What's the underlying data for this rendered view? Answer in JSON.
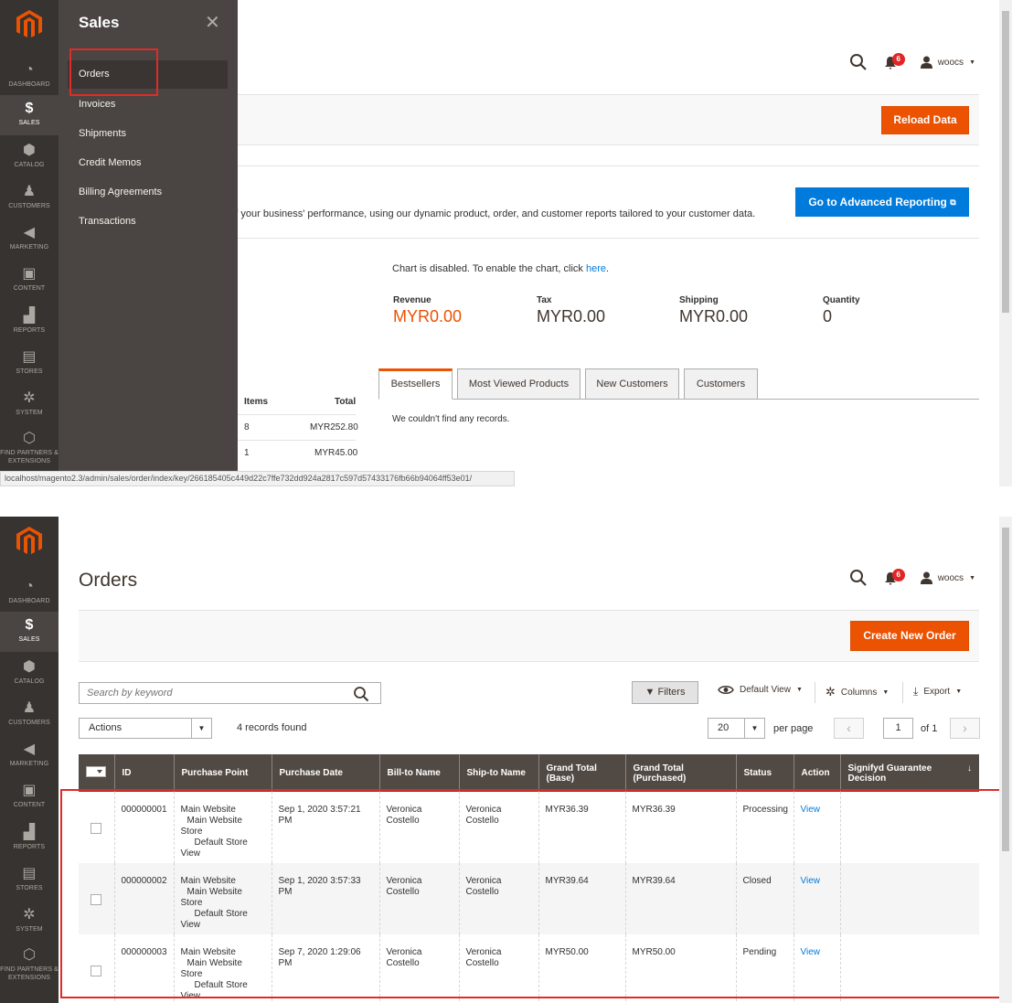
{
  "top": {
    "sidebar": [
      {
        "icon": "dashboard-icon",
        "label": "DASHBOARD"
      },
      {
        "icon": "dollar-icon",
        "label": "SALES"
      },
      {
        "icon": "cube-icon",
        "label": "CATALOG"
      },
      {
        "icon": "person-icon",
        "label": "CUSTOMERS"
      },
      {
        "icon": "megaphone-icon",
        "label": "MARKETING"
      },
      {
        "icon": "content-icon",
        "label": "CONTENT"
      },
      {
        "icon": "bar-chart-icon",
        "label": "REPORTS"
      },
      {
        "icon": "store-icon",
        "label": "STORES"
      },
      {
        "icon": "gear-icon",
        "label": "SYSTEM"
      },
      {
        "icon": "box-icon",
        "label": "FIND PARTNERS & EXTENSIONS"
      }
    ],
    "flyout": {
      "title": "Sales",
      "items": [
        "Orders",
        "Invoices",
        "Shipments",
        "Credit Memos",
        "Billing Agreements",
        "Transactions"
      ]
    },
    "header": {
      "notifications": "6",
      "user": "woocs"
    },
    "reload_label": "Reload Data",
    "advanced_reporting_label": "Go to Advanced Reporting",
    "advanced_text": "d of your business' performance, using our dynamic product, order, and customer reports tailored to your customer data.",
    "chart_disabled_text": "Chart is disabled. To enable the chart, click ",
    "chart_here_link": "here",
    "chart_disabled_end": ".",
    "stats": [
      {
        "label": "Revenue",
        "value": "MYR0.00"
      },
      {
        "label": "Tax",
        "value": "MYR0.00"
      },
      {
        "label": "Shipping",
        "value": "MYR0.00"
      },
      {
        "label": "Quantity",
        "value": "0"
      }
    ],
    "tabs": [
      "Bestsellers",
      "Most Viewed Products",
      "New Customers",
      "Customers"
    ],
    "tab_empty": "We couldn't find any records.",
    "last_orders": {
      "headers": [
        "Items",
        "Total"
      ],
      "rows": [
        {
          "items": "8",
          "total": "MYR252.80"
        },
        {
          "items": "1",
          "total": "MYR45.00"
        }
      ]
    },
    "status_url": "localhost/magento2.3/admin/sales/order/index/key/266185405c449d22c7ffe732dd924a2817c597d57433176fb66b94064ff53e01/"
  },
  "bottom": {
    "page_title": "Orders",
    "header": {
      "notifications": "6",
      "user": "woocs"
    },
    "create_label": "Create New Order",
    "search_placeholder": "Search by keyword",
    "filters_label": "Filters",
    "view_label": "Default View",
    "columns_label": "Columns",
    "export_label": "Export",
    "actions_label": "Actions",
    "records_found": "4 records found",
    "per_page_value": "20",
    "per_page_label": "per page",
    "page_value": "1",
    "page_of": "of 1",
    "columns": [
      "ID",
      "Purchase Point",
      "Purchase Date",
      "Bill-to Name",
      "Ship-to Name",
      "Grand Total (Base)",
      "Grand Total (Purchased)",
      "Status",
      "Action",
      "Signifyd Guarantee Decision"
    ],
    "rows": [
      {
        "id": "000000001",
        "pp1": "Main Website",
        "pp2": "Main Website",
        "pp3": "Store",
        "pp4": "Default Store",
        "pp5": "View",
        "date": "Sep 1, 2020 3:57:21 PM",
        "bill1": "Veronica",
        "bill2": "Costello",
        "ship1": "Veronica",
        "ship2": "Costello",
        "base": "MYR36.39",
        "purchased": "MYR36.39",
        "status": "Processing",
        "action": "View"
      },
      {
        "id": "000000002",
        "pp1": "Main Website",
        "pp2": "Main Website",
        "pp3": "Store",
        "pp4": "Default Store",
        "pp5": "View",
        "date": "Sep 1, 2020 3:57:33 PM",
        "bill1": "Veronica",
        "bill2": "Costello",
        "ship1": "Veronica",
        "ship2": "Costello",
        "base": "MYR39.64",
        "purchased": "MYR39.64",
        "status": "Closed",
        "action": "View"
      },
      {
        "id": "000000003",
        "pp1": "Main Website",
        "pp2": "Main Website",
        "pp3": "Store",
        "pp4": "Default Store",
        "pp5": "View",
        "date": "Sep 7, 2020 1:29:06 PM",
        "bill1": "Veronica",
        "bill2": "Costello",
        "ship1": "Veronica",
        "ship2": "Costello",
        "base": "MYR50.00",
        "purchased": "MYR50.00",
        "status": "Pending",
        "action": "View"
      }
    ]
  },
  "colors": {
    "accent": "#eb5202",
    "sidebar": "#373330",
    "flyout": "#4a4542",
    "link": "#007bdb",
    "highlight": "#e02b27"
  }
}
